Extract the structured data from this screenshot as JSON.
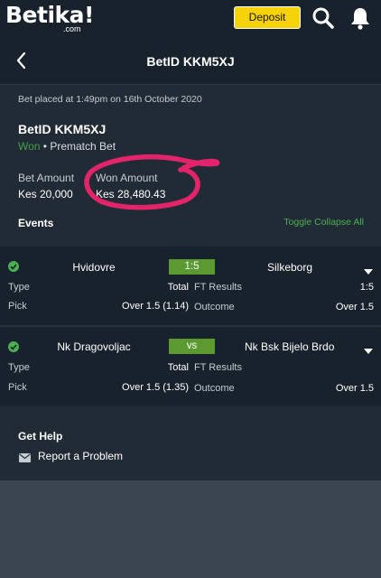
{
  "app": {
    "logo_text": "Betika!",
    "logo_sub": ".com",
    "deposit_label": "Deposit"
  },
  "header": {
    "title": "BetID KKM5XJ"
  },
  "bet": {
    "placed_text": "Bet placed at 1:49pm on 16th October 2020",
    "id_text": "BetID KKM5XJ",
    "status": "Won",
    "type_text": " • Prematch Bet",
    "amount_label": "Bet Amount",
    "amount_value": "Kes 20,000",
    "won_label": "Won Amount",
    "won_value": "Kes 28,480.43"
  },
  "events_section": {
    "title": "Events",
    "toggle_label": "Toggle Collapse All"
  },
  "events": [
    {
      "home": "Hvidovre",
      "score": "1:5",
      "away": "Silkeborg",
      "type_label": "Type",
      "type_value": "Total",
      "ft_label": "FT Results",
      "ft_value": "1:5",
      "pick_label": "Pick",
      "pick_value": "Over 1.5 (1.14)",
      "outcome_label": "Outcome",
      "outcome_value": "Over 1.5"
    },
    {
      "home": "Nk Dragovoljac",
      "score": "vs",
      "away": "Nk Bsk Bijelo Brdo",
      "type_label": "Type",
      "type_value": "Total",
      "ft_label": "FT Results",
      "ft_value": "",
      "pick_label": "Pick",
      "pick_value": "Over 1.5 (1.35)",
      "outcome_label": "Outcome",
      "outcome_value": "Over 1.5"
    }
  ],
  "help": {
    "title": "Get Help",
    "report_label": "Report a Problem"
  },
  "colors": {
    "background": "#212b36",
    "accent_yellow": "#f5d20a",
    "won_green": "#43a047",
    "score_green": "#5a9a2f",
    "annotation_pink": "#e3246b"
  },
  "icons": [
    "search-icon",
    "bell-icon",
    "back-arrow-icon",
    "check-circle-icon",
    "chevron-down-icon",
    "mail-icon"
  ]
}
